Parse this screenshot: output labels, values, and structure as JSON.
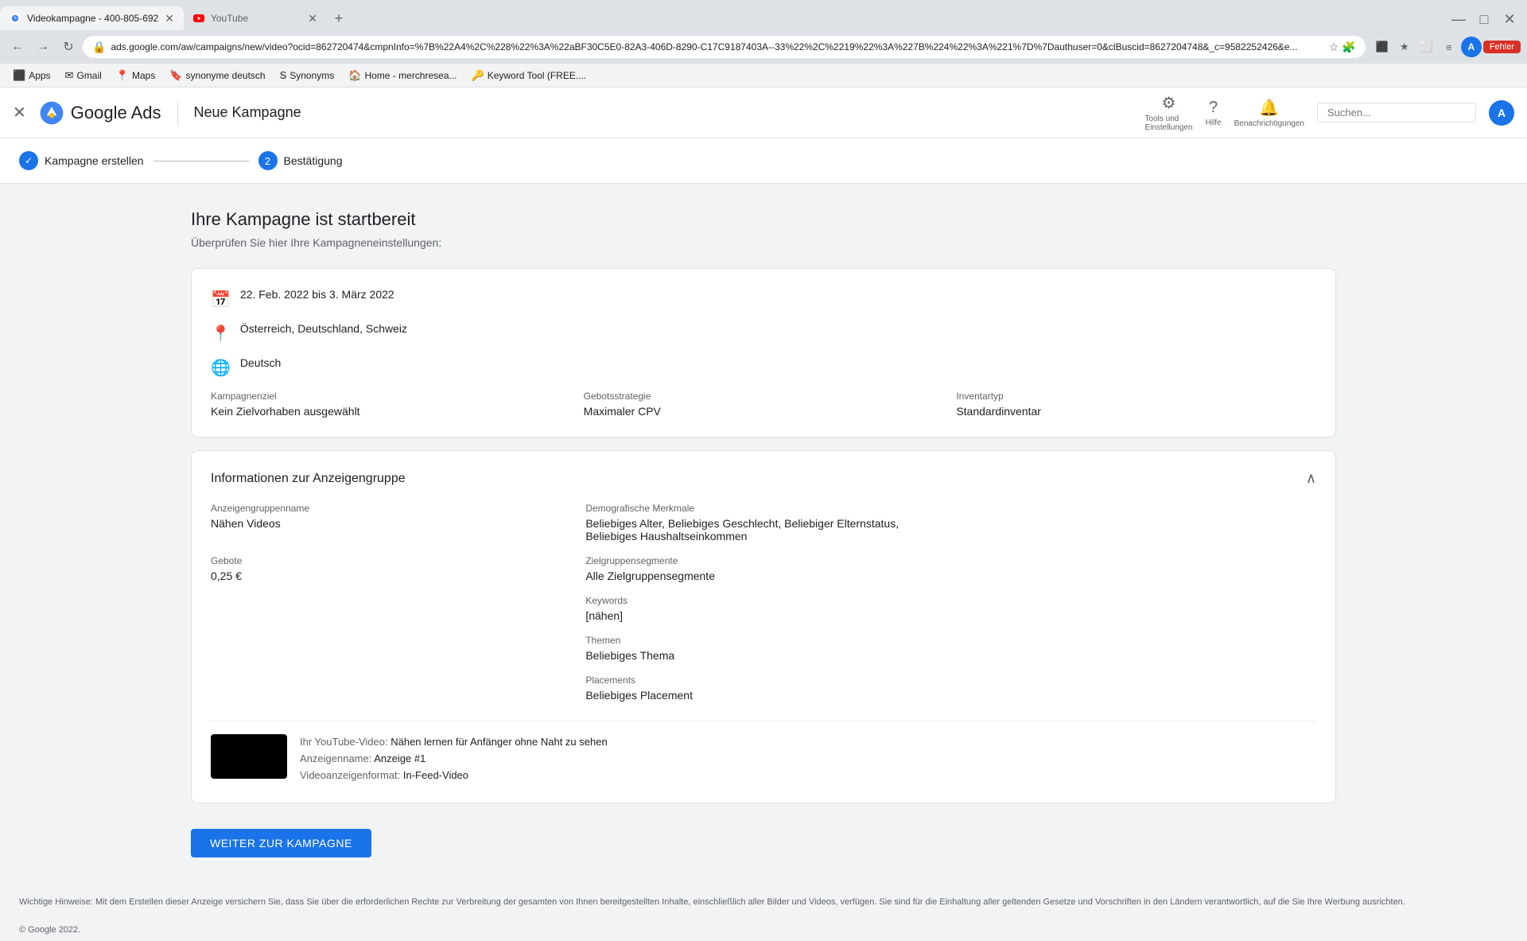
{
  "browser": {
    "tabs": [
      {
        "id": "tab1",
        "title": "Videokampagne - 400-805-692",
        "favicon": "google-ads",
        "active": true
      },
      {
        "id": "tab2",
        "title": "YouTube",
        "favicon": "youtube",
        "active": false
      }
    ],
    "add_tab_label": "+",
    "minimize": "—",
    "maximize": "□",
    "close": "✕",
    "url": "ads.google.com/aw/campaigns/new/video?ocid=862720474&cmpnInfo=%7B%22A4%2C%228%22%3A%22aBF30C5E0-82A3-406D-8290-C17C9187403A--33%22%2C%2219%22%3A%227B%224%22%3A%221%7D%7Dauthuser=0&clBuscid=8627204748&_c=9582252426&e...",
    "nav_back": "←",
    "nav_forward": "→",
    "nav_reload": "↻",
    "error_button": "Fehler"
  },
  "bookmarks": [
    {
      "id": "apps",
      "label": "Apps",
      "icon": "⬛"
    },
    {
      "id": "gmail",
      "label": "Gmail",
      "icon": "✉"
    },
    {
      "id": "maps",
      "label": "Maps",
      "icon": "📍"
    },
    {
      "id": "synonyme",
      "label": "synonyme deutsch",
      "icon": "🔖"
    },
    {
      "id": "synonyms",
      "label": "Synonyms",
      "icon": "S"
    },
    {
      "id": "home-merch",
      "label": "Home - merchresea...",
      "icon": "🏠"
    },
    {
      "id": "keyword-tool",
      "label": "Keyword Tool (FREE....",
      "icon": "🔑"
    }
  ],
  "header": {
    "close_icon": "✕",
    "logo_text": "Google Ads",
    "page_title": "Neue Kampagne",
    "tools_label": "Tools und\nEinstellungen",
    "help_label": "Hilfe",
    "notifications_label": "Benachrichtigungen",
    "user_initial": "A"
  },
  "stepper": {
    "step1": {
      "icon": "✓",
      "label": "Kampagne erstellen",
      "state": "done"
    },
    "step2": {
      "number": "2",
      "label": "Bestätigung",
      "state": "active"
    }
  },
  "main": {
    "heading": "Ihre Kampagne ist startbereit",
    "subheading": "Überprüfen Sie hier Ihre Kampagneneinstellungen:",
    "campaign_summary": {
      "date_range": "22. Feb. 2022 bis 3. März 2022",
      "location": "Österreich, Deutschland, Schweiz",
      "language": "Deutsch",
      "goal_label": "Kampagnenziel",
      "goal_value": "Kein Zielvorhaben ausgewählt",
      "bid_strategy_label": "Gebotsstrategie",
      "bid_strategy_value": "Maximaler CPV",
      "inventory_label": "Inventartyp",
      "inventory_value": "Standardinventar"
    },
    "ad_group": {
      "section_title": "Informationen zur Anzeigengruppe",
      "fields": {
        "group_name_label": "Anzeigengruppenname",
        "group_name_value": "Nähen Videos",
        "bid_label": "Gebote",
        "bid_value": "0,25 €",
        "demographics_label": "Demografische Merkmale",
        "demographics_value": "Beliebiges Alter, Beliebiges Geschlecht, Beliebiger Elternstatus, Beliebiges Haushaltseinkommen",
        "audience_label": "Zielgruppensegmente",
        "audience_value": "Alle Zielgruppensegmente",
        "keywords_label": "Keywords",
        "keywords_value": "[nähen]",
        "themes_label": "Themen",
        "themes_value": "Beliebiges Thema",
        "placements_label": "Placements",
        "placements_value": "Beliebiges Placement"
      },
      "video": {
        "label": "Ihr YouTube-Video:",
        "title": "Nähen lernen für Anfänger ohne Naht zu sehen",
        "ad_name_label": "Anzeigenname:",
        "ad_name_value": "Anzeige #1",
        "format_label": "Videoanzeigenformat:",
        "format_value": "In-Feed-Video"
      }
    },
    "cta_button": "WEITER ZUR KAMPAGNE",
    "footer_note": "Wichtige Hinweise: Mit dem Erstellen dieser Anzeige versichern Sie, dass Sie über die erforderlichen Rechte zur Verbreitung der gesamten von Ihnen bereitgestellten Inhalte, einschließlich aller Bilder und Videos, verfügen. Sie sind für die Einhaltung aller geltenden Gesetze und Vorschriften in den Ländern verantwortlich, auf die Sie Ihre Werbung ausrichten.",
    "copyright": "© Google 2022."
  }
}
